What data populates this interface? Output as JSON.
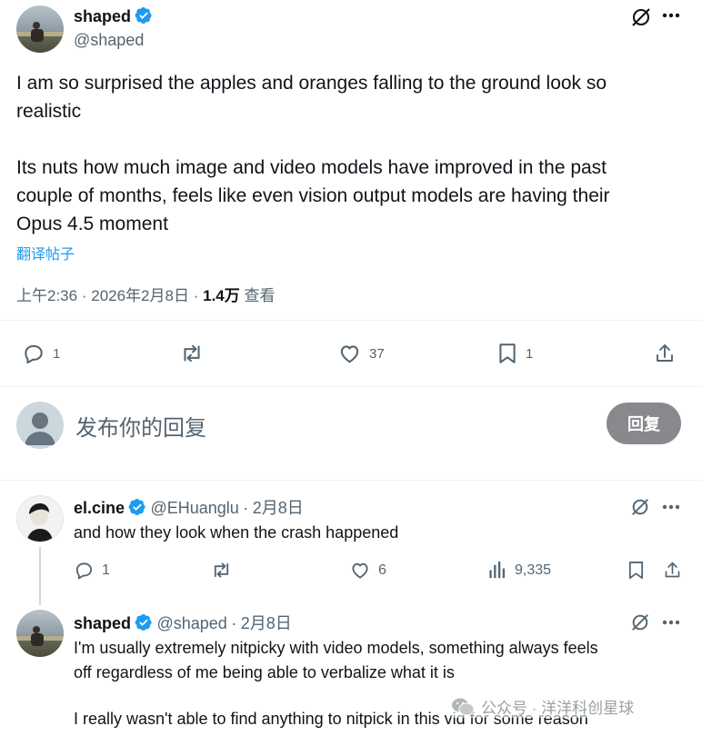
{
  "main_tweet": {
    "display_name": "shaped",
    "handle": "@shaped",
    "text_line1": "I am so surprised the apples and oranges falling to the ground look so",
    "text_line2": "realistic",
    "text_line3": "Its nuts how much image and video models have improved in the past",
    "text_line4": "couple of months, feels like even vision output models are having their",
    "text_line5": "Opus 4.5 moment",
    "translate_label": "翻译帖子",
    "time": "上午2:36",
    "date": "2026年2月8日",
    "views_count": "1.4万",
    "views_label": "查看",
    "separator": "·",
    "actions": {
      "replies": "1",
      "retweets": "",
      "likes": "37",
      "bookmarks": "1"
    }
  },
  "reply_box": {
    "placeholder": "发布你的回复",
    "button_label": "回复"
  },
  "replies": [
    {
      "display_name": "el.cine",
      "handle": "@EHuanglu",
      "date": "2月8日",
      "separator": "·",
      "text": "and how they look when the crash happened",
      "replies": "1",
      "likes": "6",
      "views": "9,335"
    },
    {
      "display_name": "shaped",
      "handle": "@shaped",
      "date": "2月8日",
      "separator": "·",
      "text_line1": "I'm usually extremely nitpicky with video models, something always feels",
      "text_line2": "off regardless of me being able to verbalize what it is",
      "text_line3": "I really wasn't able to find anything to nitpick in this vid for some reason"
    }
  ],
  "watermark": "公众号 · 洋洋科创星球",
  "colors": {
    "verified_blue": "#1d9bf0",
    "text_primary": "#0f1419",
    "text_secondary": "#536471",
    "link_blue": "#1d9bf0",
    "reply_button_bg": "#87898c"
  }
}
